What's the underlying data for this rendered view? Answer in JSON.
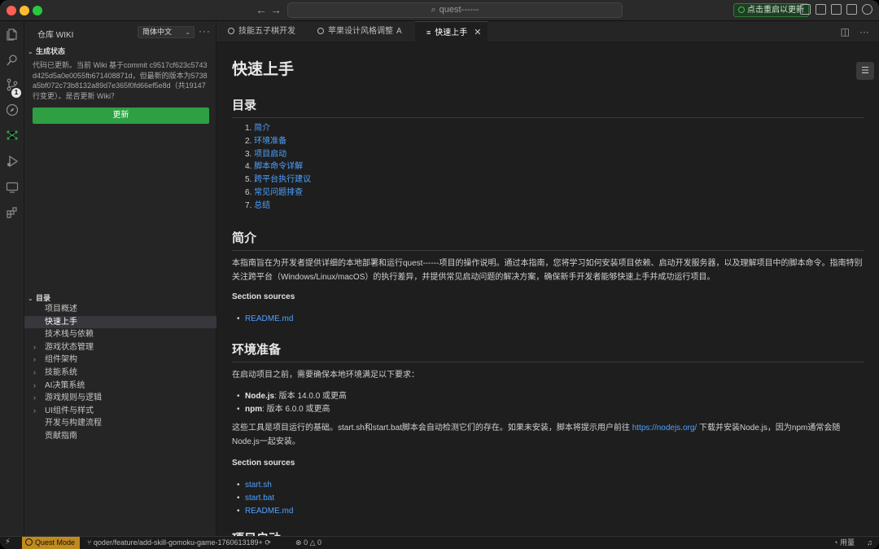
{
  "titlebar": {
    "search_text": "quest------",
    "restart_label": "点击重启以更新"
  },
  "activity": {
    "scm_badge": "1"
  },
  "sidebar": {
    "header": "仓库 WIKI",
    "language": "简体中文",
    "gen_status_title": "生成状态",
    "notice": "代码已更新。当前 Wiki 基于commit c9517cf623c5743d425d5a0e0055fb671408871d，但最新的版本为5738a5bf072c73b8132a89d7e365f0fd66ef5e8d（共19147行变更）。是否更新 Wiki？",
    "update_button": "更新",
    "toc_title": "目录",
    "toc_items": [
      {
        "label": "项目概述",
        "expandable": false,
        "active": false
      },
      {
        "label": "快速上手",
        "expandable": false,
        "active": true
      },
      {
        "label": "技术栈与依赖",
        "expandable": false,
        "active": false
      },
      {
        "label": "游戏状态管理",
        "expandable": true,
        "active": false
      },
      {
        "label": "组件架构",
        "expandable": true,
        "active": false
      },
      {
        "label": "技能系统",
        "expandable": true,
        "active": false
      },
      {
        "label": "AI决策系统",
        "expandable": true,
        "active": false
      },
      {
        "label": "游戏规则与逻辑",
        "expandable": true,
        "active": false
      },
      {
        "label": "UI组件与样式",
        "expandable": true,
        "active": false
      },
      {
        "label": "开发与构建流程",
        "expandable": false,
        "active": false
      },
      {
        "label": "贡献指南",
        "expandable": false,
        "active": false
      }
    ]
  },
  "tabs": [
    {
      "label": "技能五子棋开发",
      "active": false
    },
    {
      "label": "苹果设计风格调整",
      "active": false,
      "suffix": "A"
    },
    {
      "label": "快速上手",
      "active": true
    }
  ],
  "doc": {
    "title": "快速上手",
    "toc_heading": "目录",
    "toc": [
      "简介",
      "环境准备",
      "项目启动",
      "脚本命令详解",
      "跨平台执行建议",
      "常见问题排查",
      "总结"
    ],
    "intro_heading": "简介",
    "intro_text": "本指南旨在为开发者提供详细的本地部署和运行quest------项目的操作说明。通过本指南，您将学习如何安装项目依赖、启动开发服务器，以及理解项目中的脚本命令。指南特别关注跨平台（Windows/Linux/macOS）的执行差异，并提供常见启动问题的解决方案，确保新手开发者能够快速上手并成功运行项目。",
    "section_sources": "Section sources",
    "intro_sources": [
      "README.md"
    ],
    "env_heading": "环境准备",
    "env_text": "在启动项目之前，需要确保本地环境满足以下要求：",
    "env_reqs": [
      {
        "name": "Node.js",
        "desc": ": 版本 14.0.0 或更高"
      },
      {
        "name": "npm",
        "desc": ": 版本 6.0.0 或更高"
      }
    ],
    "env_text2_a": "这些工具是项目运行的基础。start.sh和start.bat脚本会自动检测它们的存在。如果未安装，脚本将提示用户前往 ",
    "env_link": "https://nodejs.org/",
    "env_text2_b": " 下载并安装Node.js，因为npm通常会随Node.js一起安装。",
    "env_sources": [
      "start.sh",
      "start.bat",
      "README.md"
    ],
    "next_heading": "项目启动"
  },
  "statusbar": {
    "mode": "Quest Mode",
    "branch": "qoder/feature/add-skill-gomoku-game-1760613189+",
    "errors": "0",
    "warnings": "0",
    "usage": "用量"
  }
}
